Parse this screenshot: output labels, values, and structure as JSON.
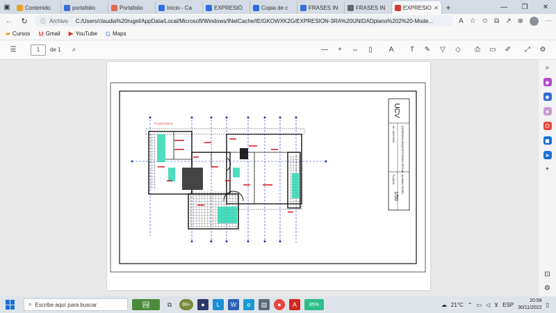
{
  "tabs": [
    {
      "title": "Contenido",
      "fav_color": "#e8a22a",
      "active": false
    },
    {
      "title": "portafolio",
      "fav_color": "#3b6fd8",
      "active": false
    },
    {
      "title": "Portafolio",
      "fav_color": "#e06a4f",
      "active": false
    },
    {
      "title": "Inicio - Ca",
      "fav_color": "#2d6fe0",
      "active": false
    },
    {
      "title": "EXPRESIÓ",
      "fav_color": "#2d6fe0",
      "active": false
    },
    {
      "title": "Copia de c",
      "fav_color": "#2d6fe0",
      "active": false
    },
    {
      "title": "FRASES IN",
      "fav_color": "#3b6fd8",
      "active": false
    },
    {
      "title": "FRASES IN",
      "fav_color": "#666666",
      "active": false
    },
    {
      "title": "EXPRESIO",
      "fav_color": "#d83b2e",
      "active": true
    }
  ],
  "address": {
    "scheme_label": "Archivo",
    "url": "C:/Users/claudia%20rugel/AppData/Local/Microsoft/Windows/INetCache/IE/GKOWXK2G/EXPRESION-3RA%20UNIDADplano%202%20-Mode..."
  },
  "bookmarks": [
    {
      "label": "Cursos",
      "icon": "folder-icon",
      "color": "#e8a22a"
    },
    {
      "label": "Gmail",
      "icon": "gmail-icon",
      "color": "#d93025"
    },
    {
      "label": "YouTube",
      "icon": "youtube-icon",
      "color": "#e52d27"
    },
    {
      "label": "Maps",
      "icon": "google-icon",
      "color": "#4285f4"
    }
  ],
  "pdf": {
    "page_value": "1",
    "page_of": "de 1"
  },
  "drawing": {
    "floor_label": "PLANTA BAJA",
    "logo": "UCV",
    "block_fecha": "06 / 06/07/2022",
    "block_titulo": "EXPRESION ARQUITECTONICA VIRTUAL",
    "block_alumna": "ALUMNA: RUGEL",
    "block_plano": "PLANOS",
    "block_escala": "1/50"
  },
  "taskbar": {
    "search_placeholder": "Escribe aquí para buscar",
    "badge": "99+",
    "battery": "85%",
    "temperature": "21°C",
    "lang": "ESP",
    "time": "20:58",
    "date": "30/11/2022"
  },
  "colors": {
    "accent": "#1a6fd4",
    "plan_blue": "#2233cc",
    "plan_red": "#e0202a",
    "plan_teal": "#2fd8b4"
  }
}
